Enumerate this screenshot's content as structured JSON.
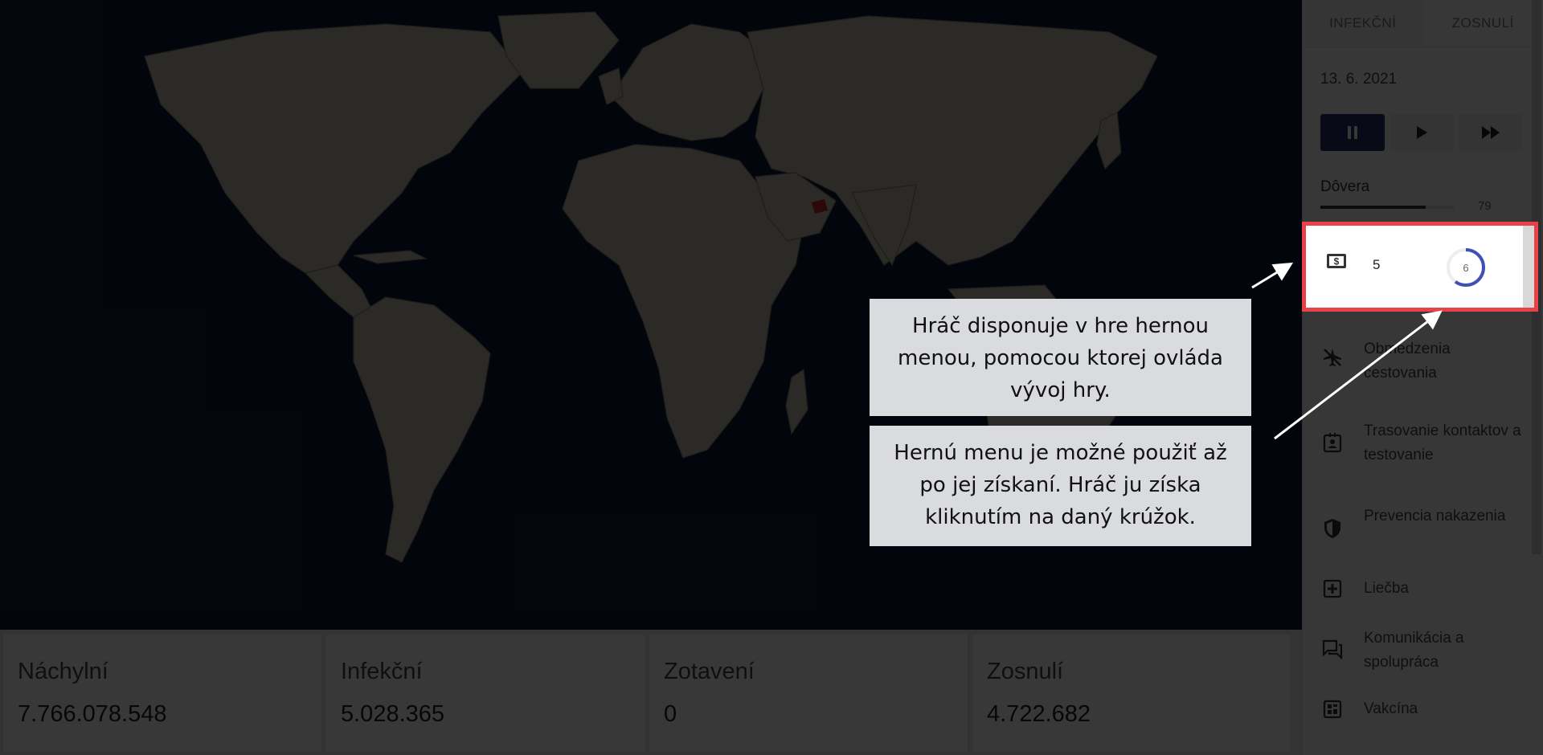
{
  "sidebar": {
    "tabs": [
      {
        "label": "INFEKČNÍ",
        "active": true
      },
      {
        "label": "ZOSNULÍ",
        "active": false
      }
    ],
    "date": "13. 6. 2021",
    "controls": [
      {
        "icon": "pause-icon",
        "active": true
      },
      {
        "icon": "play-icon",
        "active": false
      },
      {
        "icon": "fast-forward-icon",
        "active": false
      }
    ],
    "trust": {
      "label": "Dôvera",
      "value": "79",
      "fraction": 0.79
    },
    "currency": {
      "icon": "money-icon",
      "amount": "5",
      "timer": "6",
      "timer_progress": 0.6
    },
    "menu": [
      {
        "icon": "airplane-off-icon",
        "label": "Obmedzenia cestovania"
      },
      {
        "icon": "contact-badge-icon",
        "label": "Trasovanie kontaktov a testovanie"
      },
      {
        "icon": "shield-icon",
        "label": "Prevencia nakazenia"
      },
      {
        "icon": "medical-plus-icon",
        "label": "Liečba"
      },
      {
        "icon": "chat-icon",
        "label": "Komunikácia a spolupráca"
      },
      {
        "icon": "vaccine-icon",
        "label": "Vakcína"
      }
    ]
  },
  "stats": [
    {
      "label": "Náchylní",
      "value": "7.766.078.548"
    },
    {
      "label": "Infekční",
      "value": "5.028.365"
    },
    {
      "label": "Zotavení",
      "value": "0"
    },
    {
      "label": "Zosnulí",
      "value": "4.722.682"
    }
  ],
  "callouts": [
    "Hráč disponuje v hre hernou menou, pomocou ktorej ovláda vývoj hry.",
    "Hernú menu je možné použiť až po jej získaní. Hráč ju získa kliknutím na daný krúžok."
  ],
  "colors": {
    "highlight": "#e84148",
    "accent": "#2b2f6e",
    "infected_country": "#c62828"
  }
}
